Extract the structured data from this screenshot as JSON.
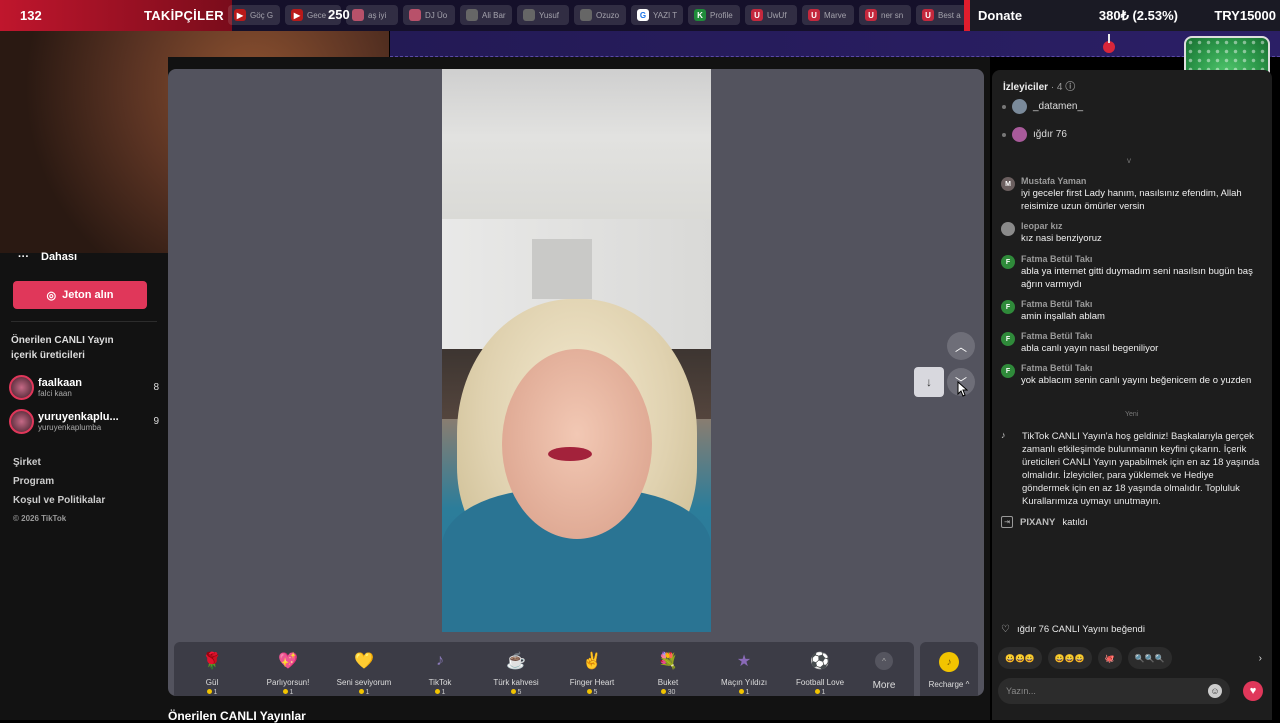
{
  "overlay": {
    "follower_count": "132",
    "follower_label": "TAKİPÇİLER",
    "viewer_count": "250",
    "chips": [
      {
        "icon": "yt",
        "label": "Göç G"
      },
      {
        "icon": "yt",
        "label": "Gece"
      },
      {
        "icon": "pink",
        "label": "aş iyi"
      },
      {
        "icon": "pink",
        "label": "DJ Üo"
      },
      {
        "icon": "gray",
        "label": "Ali Bar"
      },
      {
        "icon": "gray",
        "label": "Yusuf"
      },
      {
        "icon": "gray",
        "label": "Ozuzo"
      },
      {
        "icon": "gg",
        "label": "YAZI T"
      },
      {
        "icon": "green",
        "label": "Profile"
      },
      {
        "icon": "red",
        "label": "UwUf"
      },
      {
        "icon": "red",
        "label": "Marve"
      },
      {
        "icon": "red",
        "label": "ner sn"
      },
      {
        "icon": "red",
        "label": "Best a"
      }
    ],
    "donate_label": "Donate",
    "donate_progress": "380₺ (2.53%)",
    "donate_goal": "TRY15000"
  },
  "left_nav": {
    "more_label": "Dahası",
    "coin_button": "Jeton alın",
    "suggest_title": "Önerilen CANLI Yayın içerik üreticileri",
    "creators": [
      {
        "name": "faalkaan",
        "sub": "falci kaan",
        "count": "8"
      },
      {
        "name": "yuruyenkaplu...",
        "sub": "yuruyenkaplumba",
        "count": "9"
      }
    ],
    "footer": [
      "Şirket",
      "Program",
      "Koşul ve Politikalar"
    ],
    "copyright": "© 2026 TikTok"
  },
  "gifts": [
    {
      "name": "Gül",
      "price": "1",
      "emoji": "🌹",
      "color": "#c43a5a"
    },
    {
      "name": "Parlıyorsun!",
      "price": "1",
      "emoji": "💖",
      "color": "#d9336b"
    },
    {
      "name": "Seni seviyorum",
      "price": "1",
      "emoji": "💛",
      "color": "#e0861c"
    },
    {
      "name": "TikTok",
      "price": "1",
      "emoji": "♪",
      "color": "#8a7ab8"
    },
    {
      "name": "Türk kahvesi",
      "price": "5",
      "emoji": "☕",
      "color": "#b58a4a"
    },
    {
      "name": "Finger Heart",
      "price": "5",
      "emoji": "✌",
      "color": "#d88a6a"
    },
    {
      "name": "Buket",
      "price": "30",
      "emoji": "💐",
      "color": "#b83a5a"
    },
    {
      "name": "Maçın Yıldızı",
      "price": "1",
      "emoji": "★",
      "color": "#8a6ab8"
    },
    {
      "name": "Football Love",
      "price": "1",
      "emoji": "⚽",
      "color": "#c43a5a"
    }
  ],
  "gift_more_label": "More",
  "recharge_label": "Recharge ^",
  "bottom_heading": "Önerilen CANLI Yayınlar",
  "chat": {
    "viewers_label": "İzleyiciler",
    "viewers_count": "· 4",
    "viewers": [
      {
        "name": "_datamen_",
        "color": "#7a8a9a"
      },
      {
        "name": "ığdır 76",
        "color": "#a85a9a"
      }
    ],
    "viewers_toggle": "v",
    "messages": [
      {
        "avatar": "M",
        "user": "Mustafa Yaman",
        "text": "iyi geceler first Lady hanım, nasılsınız efendim, Allah reisimize uzun ömürler versin"
      },
      {
        "avatar": "L",
        "user": "leopar kız",
        "text": "kız nasi benziyoruz"
      },
      {
        "avatar": "F",
        "user": "Fatma Betül Takı",
        "text": "abla ya internet gitti duymadım seni nasılsın bugün baş ağrın varmıydı"
      },
      {
        "avatar": "F",
        "user": "Fatma Betül Takı",
        "text": "amin inşallah ablam"
      },
      {
        "avatar": "F",
        "user": "Fatma Betül Takı",
        "text": "abla canlı yayın nasıl begeniliyor"
      },
      {
        "avatar": "F",
        "user": "Fatma Betül Takı",
        "text": "yok ablacım senin canlı yayını beğenicem de o yuzden"
      }
    ],
    "new_divider": "Yeni",
    "welcome": "TikTok CANLI Yayın'a hoş geldiniz! Başkalarıyla gerçek zamanlı etkileşimde bulunmanın keyfini çıkarın. İçerik üreticileri CANLI Yayın yapabilmek için en az 18 yaşında olmalıdır. İzleyiciler, para yüklemek ve Hediye göndermek için en az 18 yaşında olmalıdır. Topluluk Kurallarımıza uymayı unutmayın.",
    "joined_user": "PIXANY",
    "joined_text": "katıldı",
    "liked_text": "ığdır 76 CANLI Yayını beğendi",
    "reactions": [
      "😀😀😀",
      "😀😀😀",
      "🐙",
      "🔍🔍🔍"
    ],
    "input_placeholder": "Yazın..."
  }
}
